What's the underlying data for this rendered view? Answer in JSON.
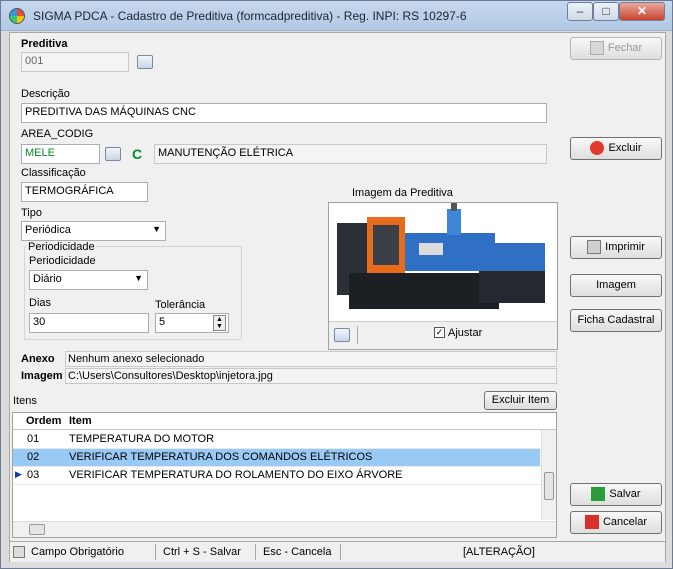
{
  "window": {
    "title": "SIGMA PDCA - Cadastro de Preditiva  (formcadpreditiva)  - Reg. INPI: RS 10297-6",
    "min": "–",
    "max": "□",
    "close": "✕"
  },
  "form": {
    "preditiva_label": "Preditiva",
    "preditiva_value": "001",
    "descricao_label": "Descrição",
    "descricao_value": "PREDITIVA DAS MÁQUINAS CNC",
    "area_label": "AREA_CODIG",
    "area_code": "MELE",
    "area_c": "C",
    "area_name": "MANUTENÇÃO ELÉTRICA",
    "classificacao_label": "Classificação",
    "classificacao_value": "TERMOGRÁFICA",
    "tipo_label": "Tipo",
    "tipo_value": "Periódica",
    "periodicidade_group": "Periodicidade",
    "periodicidade_label": "Periodicidade",
    "periodicidade_value": "Diário",
    "dias_label": "Dias",
    "dias_value": "30",
    "tolerancia_label": "Tolerância",
    "tolerancia_value": "5",
    "imagem_title": "Imagem da Preditiva",
    "ajustar_label": "Ajustar",
    "anexo_label": "Anexo",
    "anexo_value": "Nenhum anexo selecionado",
    "imagem_label": "Imagem",
    "imagem_value": "C:\\Users\\Consultores\\Desktop\\injetora.jpg",
    "itens_label": "Itens",
    "excluir_item": "Excluir Item"
  },
  "buttons": {
    "fechar": "Fechar",
    "excluir": "Excluir",
    "imprimir": "Imprimir",
    "imagem": "Imagem",
    "ficha": "Ficha Cadastral",
    "salvar": "Salvar",
    "cancelar": "Cancelar"
  },
  "grid": {
    "columns": [
      "Ordem",
      "Item"
    ],
    "rows": [
      {
        "ordem": "01",
        "item": "TEMPERATURA DO MOTOR"
      },
      {
        "ordem": "02",
        "item": "VERIFICAR TEMPERATURA DOS COMANDOS ELÉTRICOS"
      },
      {
        "ordem": "03",
        "item": "VERIFICAR TEMPERATURA DO ROLAMENTO DO EIXO ÁRVORE"
      }
    ]
  },
  "status": {
    "campo": "Campo Obrigatório",
    "salvar": "Ctrl + S - Salvar",
    "cancela": "Esc - Cancela",
    "modo": "[ALTERAÇÃO]"
  },
  "colors": {
    "selected_row": "#99c9f5",
    "area_code": "#0a8a2a"
  }
}
